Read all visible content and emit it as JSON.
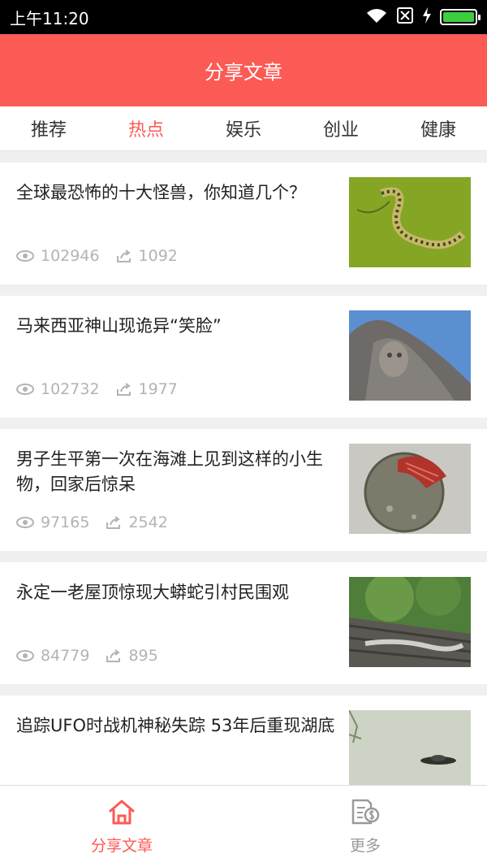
{
  "status_bar": {
    "time": "上午11:20",
    "battery_level": 1.0
  },
  "app_bar": {
    "title": "分享文章"
  },
  "tabs": [
    {
      "label": "推荐",
      "active": false
    },
    {
      "label": "热点",
      "active": true
    },
    {
      "label": "娱乐",
      "active": false
    },
    {
      "label": "创业",
      "active": false
    },
    {
      "label": "健康",
      "active": false
    }
  ],
  "articles": [
    {
      "title": "全球最恐怖的十大怪兽，你知道几个？",
      "views": "102946",
      "shares": "1092",
      "image": "snake-on-green-image"
    },
    {
      "title": "马来西亚神山现诡异“笑脸”",
      "views": "102732",
      "shares": "1977",
      "image": "mountain-face-image"
    },
    {
      "title": "男子生平第一次在海滩上见到这样的小生物，回家后惊呆",
      "views": "97165",
      "shares": "2542",
      "image": "shell-creature-image"
    },
    {
      "title": "永定一老屋顶惊现大蟒蛇引村民围观",
      "views": "84779",
      "shares": "895",
      "image": "python-on-roof-image"
    },
    {
      "title": "追踪UFO时战机神秘失踪 53年后重现湖底",
      "views": "",
      "shares": "",
      "image": "ufo-sky-image"
    }
  ],
  "bottom_nav": [
    {
      "label": "分享文章",
      "icon": "home-icon",
      "active": true
    },
    {
      "label": "更多",
      "icon": "document-money-icon",
      "active": false
    }
  ],
  "colors": {
    "accent": "#fc5a55",
    "muted": "#9a9a9a",
    "stat": "#b3b3b3"
  }
}
